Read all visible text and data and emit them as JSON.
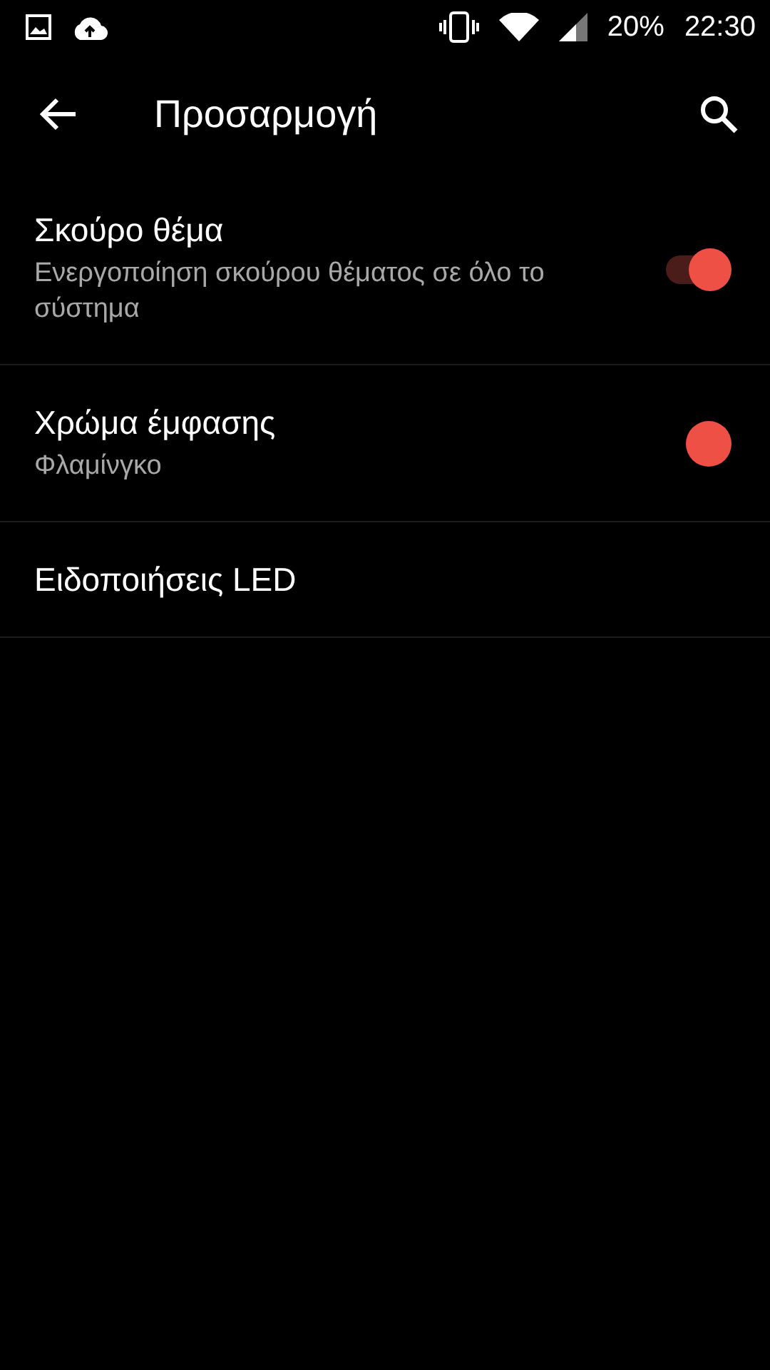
{
  "status_bar": {
    "battery": "20%",
    "time": "22:30"
  },
  "toolbar": {
    "title": "Προσαρμογή"
  },
  "settings": [
    {
      "kind": "toggle",
      "title": "Σκούρο θέμα",
      "summary": "Ενεργοποίηση σκούρου θέματος σε όλο το σύστημα",
      "on": true
    },
    {
      "kind": "color",
      "title": "Χρώμα έμφασης",
      "summary": "Φλαμίνγκο",
      "color": "#ef5045"
    },
    {
      "kind": "plain",
      "title": "Ειδοποιήσεις LED"
    }
  ]
}
